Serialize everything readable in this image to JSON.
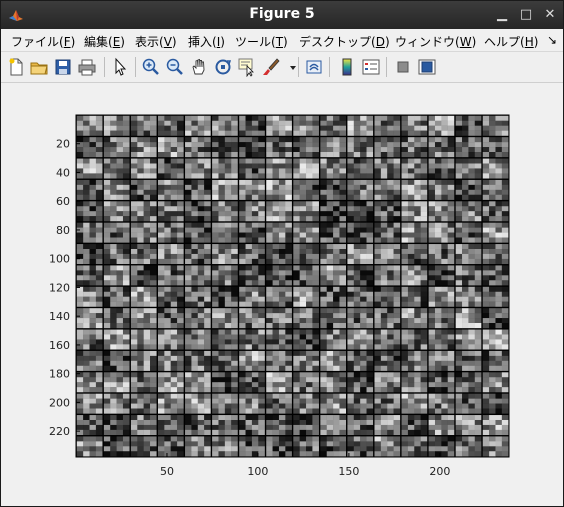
{
  "window": {
    "title": "Figure 5",
    "buttons": [
      "minimize",
      "maximize",
      "close"
    ]
  },
  "menu": {
    "items": [
      {
        "label": "ファイル(",
        "key": "F",
        "tail": ")"
      },
      {
        "label": "編集(",
        "key": "E",
        "tail": ")"
      },
      {
        "label": "表示(",
        "key": "V",
        "tail": ")"
      },
      {
        "label": "挿入(",
        "key": "I",
        "tail": ")"
      },
      {
        "label": "ツール(",
        "key": "T",
        "tail": ")"
      },
      {
        "label": "デスクトップ(",
        "key": "D",
        "tail": ")"
      },
      {
        "label": "ウィンドウ(",
        "key": "W",
        "tail": ")"
      },
      {
        "label": "ヘルプ(",
        "key": "H",
        "tail": ")"
      }
    ],
    "overflow_glyph": "↘"
  },
  "toolbar": {
    "icons": [
      "new-figure-icon",
      "open-file-icon",
      "save-icon",
      "print-icon",
      "pointer-icon",
      "zoom-in-icon",
      "zoom-out-icon",
      "pan-hand-icon",
      "rotate-3d-icon",
      "data-cursor-icon",
      "brush-icon",
      "brush-dropdown-icon",
      "link-plot-icon",
      "colorbar-icon",
      "legend-icon",
      "hide-plot-tools-icon",
      "show-plot-tools-icon"
    ]
  },
  "chart_data": {
    "type": "heatmap",
    "description_grid": [
      16,
      16
    ],
    "colormap": "gray",
    "xlim": [
      0,
      238
    ],
    "ylim": [
      0,
      238
    ],
    "x_ticks": [
      50,
      100,
      150,
      200
    ],
    "y_ticks": [
      20,
      40,
      60,
      80,
      100,
      120,
      140,
      160,
      180,
      200,
      220
    ]
  },
  "colors": {
    "titlebar": "#2e2e2e",
    "figure_bg": "#f0f0f0",
    "axes_border": "#000000"
  }
}
